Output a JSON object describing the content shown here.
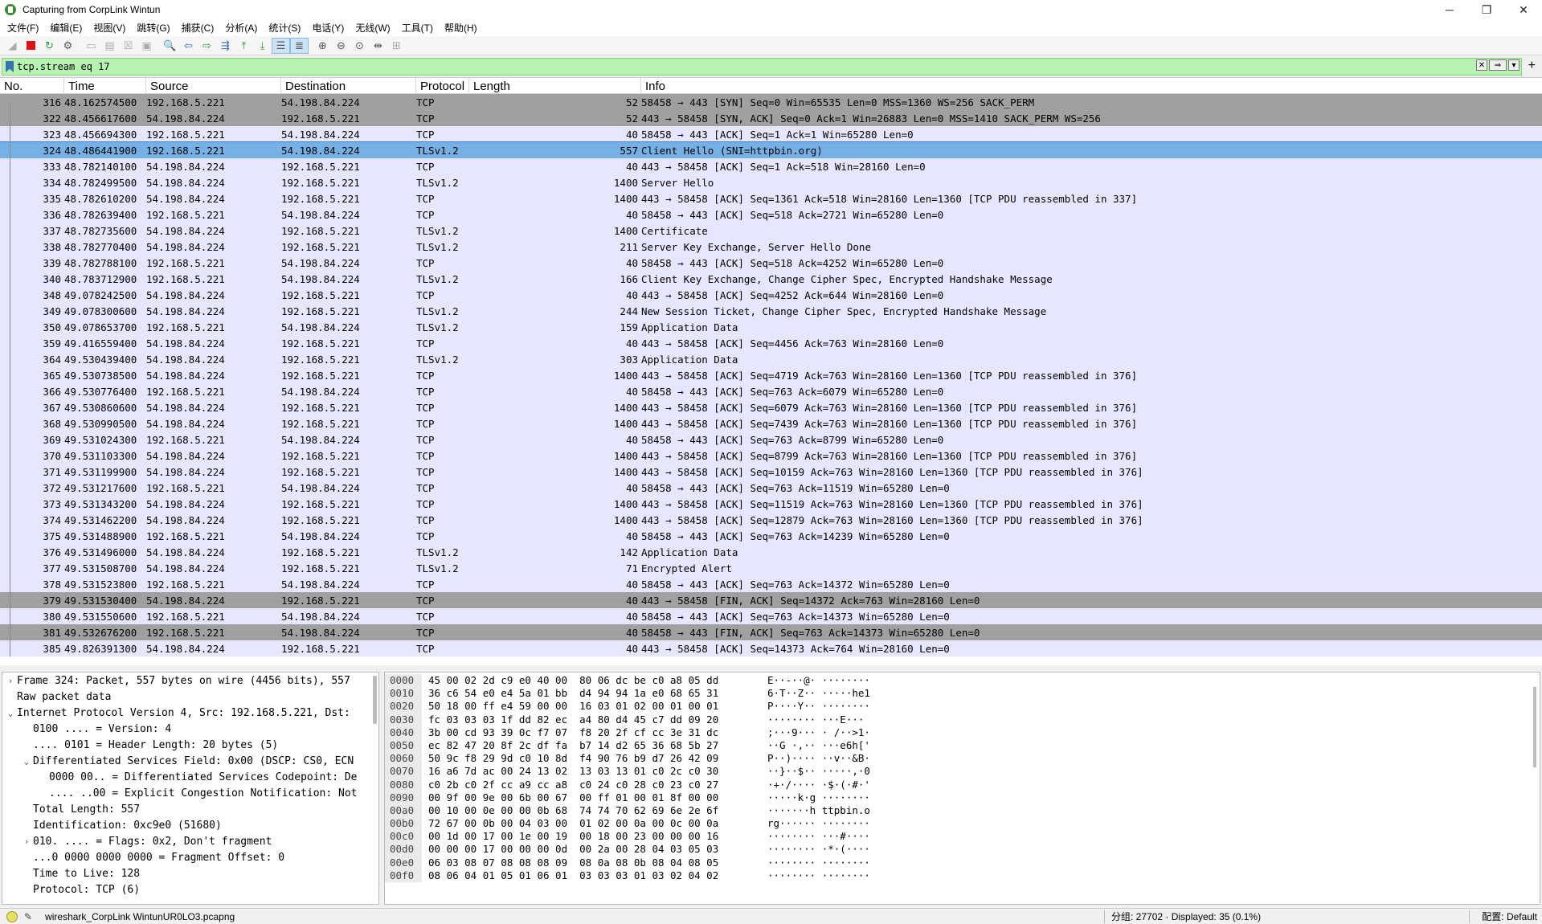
{
  "window": {
    "title": "Capturing from CorpLink Wintun"
  },
  "window_controls": {
    "minimize": "─",
    "maximize": "❐",
    "close": "✕"
  },
  "menu": [
    "文件(F)",
    "编辑(E)",
    "视图(V)",
    "跳转(G)",
    "捕获(C)",
    "分析(A)",
    "统计(S)",
    "电话(Y)",
    "无线(W)",
    "工具(T)",
    "帮助(H)"
  ],
  "filter": {
    "value": "tcp.stream eq 17"
  },
  "columns": [
    "No.",
    "Time",
    "Source",
    "Destination",
    "Protocol",
    "Length",
    "Info"
  ],
  "packets": [
    {
      "no": "316",
      "time": "48.162574500",
      "src": "192.168.5.221",
      "dst": "54.198.84.224",
      "proto": "TCP",
      "len": "52",
      "info": "58458 → 443 [SYN] Seq=0 Win=65535 Len=0 MSS=1360 WS=256 SACK_PERM",
      "style": "dark"
    },
    {
      "no": "322",
      "time": "48.456617600",
      "src": "54.198.84.224",
      "dst": "192.168.5.221",
      "proto": "TCP",
      "len": "52",
      "info": "443 → 58458 [SYN, ACK] Seq=0 Ack=1 Win=26883 Len=0 MSS=1410 SACK_PERM WS=256",
      "style": "dark"
    },
    {
      "no": "323",
      "time": "48.456694300",
      "src": "192.168.5.221",
      "dst": "54.198.84.224",
      "proto": "TCP",
      "len": "40",
      "info": "58458 → 443 [ACK] Seq=1 Ack=1 Win=65280 Len=0",
      "style": ""
    },
    {
      "no": "324",
      "time": "48.486441900",
      "src": "192.168.5.221",
      "dst": "54.198.84.224",
      "proto": "TLSv1.2",
      "len": "557",
      "info": "Client Hello (SNI=httpbin.org)",
      "style": "sel"
    },
    {
      "no": "333",
      "time": "48.782140100",
      "src": "54.198.84.224",
      "dst": "192.168.5.221",
      "proto": "TCP",
      "len": "40",
      "info": "443 → 58458 [ACK] Seq=1 Ack=518 Win=28160 Len=0",
      "style": ""
    },
    {
      "no": "334",
      "time": "48.782499500",
      "src": "54.198.84.224",
      "dst": "192.168.5.221",
      "proto": "TLSv1.2",
      "len": "1400",
      "info": "Server Hello",
      "style": ""
    },
    {
      "no": "335",
      "time": "48.782610200",
      "src": "54.198.84.224",
      "dst": "192.168.5.221",
      "proto": "TCP",
      "len": "1400",
      "info": "443 → 58458 [ACK] Seq=1361 Ack=518 Win=28160 Len=1360 [TCP PDU reassembled in 337]",
      "style": ""
    },
    {
      "no": "336",
      "time": "48.782639400",
      "src": "192.168.5.221",
      "dst": "54.198.84.224",
      "proto": "TCP",
      "len": "40",
      "info": "58458 → 443 [ACK] Seq=518 Ack=2721 Win=65280 Len=0",
      "style": ""
    },
    {
      "no": "337",
      "time": "48.782735600",
      "src": "54.198.84.224",
      "dst": "192.168.5.221",
      "proto": "TLSv1.2",
      "len": "1400",
      "info": "Certificate",
      "style": ""
    },
    {
      "no": "338",
      "time": "48.782770400",
      "src": "54.198.84.224",
      "dst": "192.168.5.221",
      "proto": "TLSv1.2",
      "len": "211",
      "info": "Server Key Exchange, Server Hello Done",
      "style": ""
    },
    {
      "no": "339",
      "time": "48.782788100",
      "src": "192.168.5.221",
      "dst": "54.198.84.224",
      "proto": "TCP",
      "len": "40",
      "info": "58458 → 443 [ACK] Seq=518 Ack=4252 Win=65280 Len=0",
      "style": ""
    },
    {
      "no": "340",
      "time": "48.783712900",
      "src": "192.168.5.221",
      "dst": "54.198.84.224",
      "proto": "TLSv1.2",
      "len": "166",
      "info": "Client Key Exchange, Change Cipher Spec, Encrypted Handshake Message",
      "style": ""
    },
    {
      "no": "348",
      "time": "49.078242500",
      "src": "54.198.84.224",
      "dst": "192.168.5.221",
      "proto": "TCP",
      "len": "40",
      "info": "443 → 58458 [ACK] Seq=4252 Ack=644 Win=28160 Len=0",
      "style": ""
    },
    {
      "no": "349",
      "time": "49.078300600",
      "src": "54.198.84.224",
      "dst": "192.168.5.221",
      "proto": "TLSv1.2",
      "len": "244",
      "info": "New Session Ticket, Change Cipher Spec, Encrypted Handshake Message",
      "style": ""
    },
    {
      "no": "350",
      "time": "49.078653700",
      "src": "192.168.5.221",
      "dst": "54.198.84.224",
      "proto": "TLSv1.2",
      "len": "159",
      "info": "Application Data",
      "style": ""
    },
    {
      "no": "359",
      "time": "49.416559400",
      "src": "54.198.84.224",
      "dst": "192.168.5.221",
      "proto": "TCP",
      "len": "40",
      "info": "443 → 58458 [ACK] Seq=4456 Ack=763 Win=28160 Len=0",
      "style": ""
    },
    {
      "no": "364",
      "time": "49.530439400",
      "src": "54.198.84.224",
      "dst": "192.168.5.221",
      "proto": "TLSv1.2",
      "len": "303",
      "info": "Application Data",
      "style": ""
    },
    {
      "no": "365",
      "time": "49.530738500",
      "src": "54.198.84.224",
      "dst": "192.168.5.221",
      "proto": "TCP",
      "len": "1400",
      "info": "443 → 58458 [ACK] Seq=4719 Ack=763 Win=28160 Len=1360 [TCP PDU reassembled in 376]",
      "style": ""
    },
    {
      "no": "366",
      "time": "49.530776400",
      "src": "192.168.5.221",
      "dst": "54.198.84.224",
      "proto": "TCP",
      "len": "40",
      "info": "58458 → 443 [ACK] Seq=763 Ack=6079 Win=65280 Len=0",
      "style": ""
    },
    {
      "no": "367",
      "time": "49.530860600",
      "src": "54.198.84.224",
      "dst": "192.168.5.221",
      "proto": "TCP",
      "len": "1400",
      "info": "443 → 58458 [ACK] Seq=6079 Ack=763 Win=28160 Len=1360 [TCP PDU reassembled in 376]",
      "style": ""
    },
    {
      "no": "368",
      "time": "49.530990500",
      "src": "54.198.84.224",
      "dst": "192.168.5.221",
      "proto": "TCP",
      "len": "1400",
      "info": "443 → 58458 [ACK] Seq=7439 Ack=763 Win=28160 Len=1360 [TCP PDU reassembled in 376]",
      "style": ""
    },
    {
      "no": "369",
      "time": "49.531024300",
      "src": "192.168.5.221",
      "dst": "54.198.84.224",
      "proto": "TCP",
      "len": "40",
      "info": "58458 → 443 [ACK] Seq=763 Ack=8799 Win=65280 Len=0",
      "style": ""
    },
    {
      "no": "370",
      "time": "49.531103300",
      "src": "54.198.84.224",
      "dst": "192.168.5.221",
      "proto": "TCP",
      "len": "1400",
      "info": "443 → 58458 [ACK] Seq=8799 Ack=763 Win=28160 Len=1360 [TCP PDU reassembled in 376]",
      "style": ""
    },
    {
      "no": "371",
      "time": "49.531199900",
      "src": "54.198.84.224",
      "dst": "192.168.5.221",
      "proto": "TCP",
      "len": "1400",
      "info": "443 → 58458 [ACK] Seq=10159 Ack=763 Win=28160 Len=1360 [TCP PDU reassembled in 376]",
      "style": ""
    },
    {
      "no": "372",
      "time": "49.531217600",
      "src": "192.168.5.221",
      "dst": "54.198.84.224",
      "proto": "TCP",
      "len": "40",
      "info": "58458 → 443 [ACK] Seq=763 Ack=11519 Win=65280 Len=0",
      "style": ""
    },
    {
      "no": "373",
      "time": "49.531343200",
      "src": "54.198.84.224",
      "dst": "192.168.5.221",
      "proto": "TCP",
      "len": "1400",
      "info": "443 → 58458 [ACK] Seq=11519 Ack=763 Win=28160 Len=1360 [TCP PDU reassembled in 376]",
      "style": ""
    },
    {
      "no": "374",
      "time": "49.531462200",
      "src": "54.198.84.224",
      "dst": "192.168.5.221",
      "proto": "TCP",
      "len": "1400",
      "info": "443 → 58458 [ACK] Seq=12879 Ack=763 Win=28160 Len=1360 [TCP PDU reassembled in 376]",
      "style": ""
    },
    {
      "no": "375",
      "time": "49.531488900",
      "src": "192.168.5.221",
      "dst": "54.198.84.224",
      "proto": "TCP",
      "len": "40",
      "info": "58458 → 443 [ACK] Seq=763 Ack=14239 Win=65280 Len=0",
      "style": ""
    },
    {
      "no": "376",
      "time": "49.531496000",
      "src": "54.198.84.224",
      "dst": "192.168.5.221",
      "proto": "TLSv1.2",
      "len": "142",
      "info": "Application Data",
      "style": ""
    },
    {
      "no": "377",
      "time": "49.531508700",
      "src": "54.198.84.224",
      "dst": "192.168.5.221",
      "proto": "TLSv1.2",
      "len": "71",
      "info": "Encrypted Alert",
      "style": ""
    },
    {
      "no": "378",
      "time": "49.531523800",
      "src": "192.168.5.221",
      "dst": "54.198.84.224",
      "proto": "TCP",
      "len": "40",
      "info": "58458 → 443 [ACK] Seq=763 Ack=14372 Win=65280 Len=0",
      "style": ""
    },
    {
      "no": "379",
      "time": "49.531530400",
      "src": "54.198.84.224",
      "dst": "192.168.5.221",
      "proto": "TCP",
      "len": "40",
      "info": "443 → 58458 [FIN, ACK] Seq=14372 Ack=763 Win=28160 Len=0",
      "style": "dark"
    },
    {
      "no": "380",
      "time": "49.531550600",
      "src": "192.168.5.221",
      "dst": "54.198.84.224",
      "proto": "TCP",
      "len": "40",
      "info": "58458 → 443 [ACK] Seq=763 Ack=14373 Win=65280 Len=0",
      "style": ""
    },
    {
      "no": "381",
      "time": "49.532676200",
      "src": "192.168.5.221",
      "dst": "54.198.84.224",
      "proto": "TCP",
      "len": "40",
      "info": "58458 → 443 [FIN, ACK] Seq=763 Ack=14373 Win=65280 Len=0",
      "style": "dark"
    },
    {
      "no": "385",
      "time": "49.826391300",
      "src": "54.198.84.224",
      "dst": "192.168.5.221",
      "proto": "TCP",
      "len": "40",
      "info": "443 → 58458 [ACK] Seq=14373 Ack=764 Win=28160 Len=0",
      "style": ""
    }
  ],
  "details": [
    {
      "indent": 0,
      "arrow": ">",
      "text": "Frame 324: Packet, 557 bytes on wire (4456 bits), 557"
    },
    {
      "indent": 0,
      "arrow": "",
      "text": "Raw packet data"
    },
    {
      "indent": 0,
      "arrow": "v",
      "text": "Internet Protocol Version 4, Src: 192.168.5.221, Dst:"
    },
    {
      "indent": 1,
      "arrow": "",
      "text": "0100 .... = Version: 4"
    },
    {
      "indent": 1,
      "arrow": "",
      "text": ".... 0101 = Header Length: 20 bytes (5)"
    },
    {
      "indent": 1,
      "arrow": "v",
      "text": "Differentiated Services Field: 0x00 (DSCP: CS0, ECN"
    },
    {
      "indent": 2,
      "arrow": "",
      "text": "0000 00.. = Differentiated Services Codepoint: De"
    },
    {
      "indent": 2,
      "arrow": "",
      "text": ".... ..00 = Explicit Congestion Notification: Not"
    },
    {
      "indent": 1,
      "arrow": "",
      "text": "Total Length: 557"
    },
    {
      "indent": 1,
      "arrow": "",
      "text": "Identification: 0xc9e0 (51680)"
    },
    {
      "indent": 1,
      "arrow": ">",
      "text": "010. .... = Flags: 0x2, Don't fragment"
    },
    {
      "indent": 1,
      "arrow": "",
      "text": "...0 0000 0000 0000 = Fragment Offset: 0"
    },
    {
      "indent": 1,
      "arrow": "",
      "text": "Time to Live: 128"
    },
    {
      "indent": 1,
      "arrow": "",
      "text": "Protocol: TCP (6)"
    }
  ],
  "bytes": [
    {
      "off": "0000",
      "hex": "45 00 02 2d c9 e0 40 00  80 06 dc be c0 a8 05 dd",
      "ascii": "E··-··@· ········"
    },
    {
      "off": "0010",
      "hex": "36 c6 54 e0 e4 5a 01 bb  d4 94 94 1a e0 68 65 31",
      "ascii": "6·T··Z·· ·····he1"
    },
    {
      "off": "0020",
      "hex": "50 18 00 ff e4 59 00 00  16 03 01 02 00 01 00 01",
      "ascii": "P····Y·· ········"
    },
    {
      "off": "0030",
      "hex": "fc 03 03 03 1f dd 82 ec  a4 80 d4 45 c7 dd 09 20",
      "ascii": "········ ···E··· "
    },
    {
      "off": "0040",
      "hex": "3b 00 cd 93 39 0c f7 07  f8 20 2f cf cc 3e 31 dc",
      "ascii": ";···9··· · /··>1·"
    },
    {
      "off": "0050",
      "hex": "ec 82 47 20 8f 2c df fa  b7 14 d2 65 36 68 5b 27",
      "ascii": "··G ·,·· ···e6h['"
    },
    {
      "off": "0060",
      "hex": "50 9c f8 29 9d c0 10 8d  f4 90 76 b9 d7 26 42 09",
      "ascii": "P··)···· ··v··&B·"
    },
    {
      "off": "0070",
      "hex": "16 a6 7d ac 00 24 13 02  13 03 13 01 c0 2c c0 30",
      "ascii": "··}··$·· ·····,·0"
    },
    {
      "off": "0080",
      "hex": "c0 2b c0 2f cc a9 cc a8  c0 24 c0 28 c0 23 c0 27",
      "ascii": "·+·/···· ·$·(·#·'"
    },
    {
      "off": "0090",
      "hex": "00 9f 00 9e 00 6b 00 67  00 ff 01 00 01 8f 00 00",
      "ascii": "·····k·g ········"
    },
    {
      "off": "00a0",
      "hex": "00 10 00 0e 00 00 0b 68  74 74 70 62 69 6e 2e 6f",
      "ascii": "·······h ttpbin.o"
    },
    {
      "off": "00b0",
      "hex": "72 67 00 0b 00 04 03 00  01 02 00 0a 00 0c 00 0a",
      "ascii": "rg······ ········"
    },
    {
      "off": "00c0",
      "hex": "00 1d 00 17 00 1e 00 19  00 18 00 23 00 00 00 16",
      "ascii": "········ ···#····"
    },
    {
      "off": "00d0",
      "hex": "00 00 00 17 00 00 00 0d  00 2a 00 28 04 03 05 03",
      "ascii": "········ ·*·(····"
    },
    {
      "off": "00e0",
      "hex": "06 03 08 07 08 08 08 09  08 0a 08 0b 08 04 08 05",
      "ascii": "········ ········"
    },
    {
      "off": "00f0",
      "hex": "08 06 04 01 05 01 06 01  03 03 03 01 03 02 04 02",
      "ascii": "········ ········"
    }
  ],
  "status": {
    "file": "wireshark_CorpLink WintunUR0LO3.pcapng",
    "packets": "分组: 27702 · Displayed: 35 (0.1%)",
    "profile": "配置: Default"
  }
}
